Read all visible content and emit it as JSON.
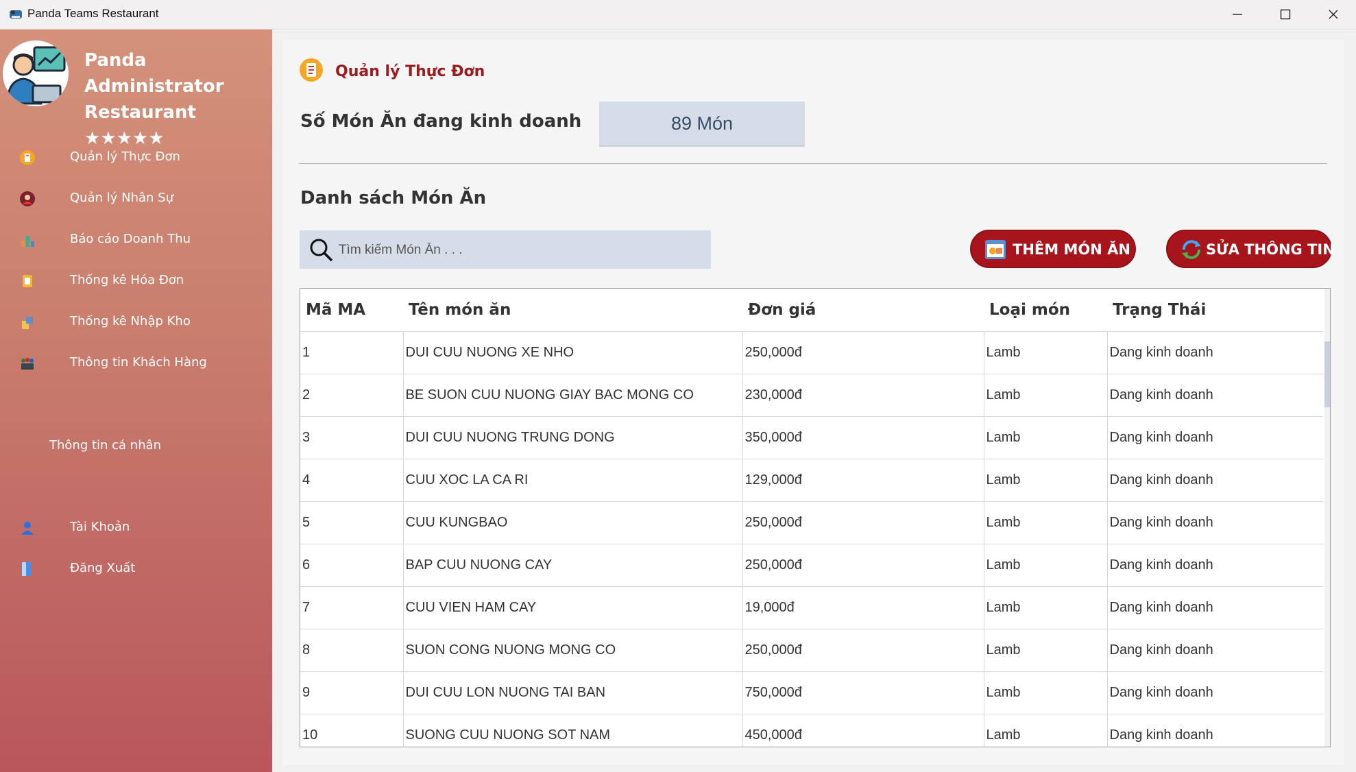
{
  "window": {
    "title": "Panda Teams Restaurant"
  },
  "sidebar": {
    "brand_line1": "Panda Administrator",
    "brand_line2": "Restaurant ★★★★★",
    "items": [
      {
        "label": "Quản lý Thực Đơn",
        "icon": "menu-icon"
      },
      {
        "label": "Quản lý Nhân Sự",
        "icon": "staff-icon"
      },
      {
        "label": "Báo cáo Doanh Thu",
        "icon": "revenue-chart-icon"
      },
      {
        "label": "Thống kê Hóa Đơn",
        "icon": "invoice-icon"
      },
      {
        "label": "Thống kê Nhập Kho",
        "icon": "warehouse-icon"
      },
      {
        "label": "Thông tin Khách Hàng",
        "icon": "customers-icon"
      }
    ],
    "profile_section": "Thông tin cá nhân",
    "account_items": [
      {
        "label": "Tài Khoản",
        "icon": "user-icon"
      },
      {
        "label": "Đăng Xuất",
        "icon": "logout-door-icon"
      }
    ]
  },
  "main": {
    "title": "Quản lý Thực Đơn",
    "count_label": "Số Món Ăn đang kinh doanh",
    "count_value": "89 Món",
    "list_title": "Danh sách Món Ăn",
    "search_placeholder": "Tìm kiếm Món Ăn . . .",
    "add_button": "THÊM MÓN ĂN",
    "edit_button": "SỬA THÔNG TIN"
  },
  "table": {
    "columns": [
      "Mã MA",
      "Tên món ăn",
      "Đơn giá",
      "Loại món",
      "Trạng Thái"
    ],
    "rows": [
      [
        "1",
        "DUI CUU NUONG XE NHO",
        "250,000đ",
        "Lamb",
        "Dang kinh doanh"
      ],
      [
        "2",
        "BE SUON CUU NUONG GIAY BAC MONG CO",
        "230,000đ",
        "Lamb",
        "Dang kinh doanh"
      ],
      [
        "3",
        "DUI CUU NUONG TRUNG DONG",
        "350,000đ",
        "Lamb",
        "Dang kinh doanh"
      ],
      [
        "4",
        "CUU XOC LA CA RI",
        "129,000đ",
        "Lamb",
        "Dang kinh doanh"
      ],
      [
        "5",
        "CUU KUNGBAO",
        "250,000đ",
        "Lamb",
        "Dang kinh doanh"
      ],
      [
        "6",
        "BAP CUU NUONG CAY",
        "250,000đ",
        "Lamb",
        "Dang kinh doanh"
      ],
      [
        "7",
        "CUU VIEN HAM CAY",
        "19,000đ",
        "Lamb",
        "Dang kinh doanh"
      ],
      [
        "8",
        "SUON CONG NUONG MONG CO",
        "250,000đ",
        "Lamb",
        "Dang kinh doanh"
      ],
      [
        "9",
        "DUI CUU LON NUONG TAI BAN",
        "750,000đ",
        "Lamb",
        "Dang kinh doanh"
      ],
      [
        "10",
        "SUONG CUU NUONG SOT NAM",
        "450,000đ",
        "Lamb",
        "Dang kinh doanh"
      ]
    ]
  },
  "colors": {
    "accent": "#a8141b",
    "sidebar_top": "#d4917a",
    "sidebar_bottom": "#b9565c",
    "input_bg": "#d6dce8"
  }
}
